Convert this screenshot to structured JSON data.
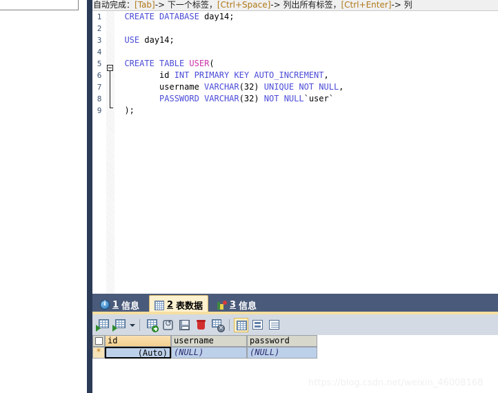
{
  "hint_bar": {
    "prefix": "自动完成：",
    "segments": [
      {
        "key": "[Tab]",
        "arrow": "-> ",
        "text": "下一个标签，"
      },
      {
        "key": "[Ctrl+Space]",
        "arrow": "-> ",
        "text": "列出所有标签，"
      },
      {
        "key": "[Ctrl+Enter]",
        "arrow": "-> ",
        "text": "列"
      }
    ],
    "full_text": "自动完成：[Tab]-> 下一个标签，[Ctrl+Space]-> 列出所有标签，[Ctrl+Enter]-> 列"
  },
  "editor": {
    "line_numbers": [
      "1",
      "2",
      "3",
      "4",
      "5",
      "6",
      "7",
      "8",
      "9"
    ],
    "lines": [
      {
        "n": "1",
        "tokens": [
          {
            "t": "  ",
            "c": "plain"
          },
          {
            "t": "CREATE",
            "c": "kw"
          },
          {
            "t": " ",
            "c": "plain"
          },
          {
            "t": "DATABASE",
            "c": "kw"
          },
          {
            "t": " day14;",
            "c": "plain"
          }
        ]
      },
      {
        "n": "2",
        "tokens": []
      },
      {
        "n": "3",
        "tokens": [
          {
            "t": "  ",
            "c": "plain"
          },
          {
            "t": "USE",
            "c": "kw"
          },
          {
            "t": " day14;",
            "c": "plain"
          }
        ]
      },
      {
        "n": "4",
        "tokens": []
      },
      {
        "n": "5",
        "tokens": [
          {
            "t": "  ",
            "c": "plain"
          },
          {
            "t": "CREATE",
            "c": "kw"
          },
          {
            "t": " ",
            "c": "plain"
          },
          {
            "t": "TABLE",
            "c": "kw"
          },
          {
            "t": " ",
            "c": "plain"
          },
          {
            "t": "USER",
            "c": "tbl"
          },
          {
            "t": "(",
            "c": "plain"
          }
        ]
      },
      {
        "n": "6",
        "tokens": [
          {
            "t": "         id ",
            "c": "plain"
          },
          {
            "t": "INT",
            "c": "kw"
          },
          {
            "t": " ",
            "c": "plain"
          },
          {
            "t": "PRIMARY",
            "c": "kw"
          },
          {
            "t": " ",
            "c": "plain"
          },
          {
            "t": "KEY",
            "c": "kw"
          },
          {
            "t": " ",
            "c": "plain"
          },
          {
            "t": "AUTO_INCREMENT",
            "c": "kw"
          },
          {
            "t": ",",
            "c": "plain"
          }
        ]
      },
      {
        "n": "7",
        "tokens": [
          {
            "t": "         username ",
            "c": "plain"
          },
          {
            "t": "VARCHAR",
            "c": "kw"
          },
          {
            "t": "(32) ",
            "c": "plain"
          },
          {
            "t": "UNIQUE",
            "c": "kw"
          },
          {
            "t": " ",
            "c": "plain"
          },
          {
            "t": "NOT",
            "c": "kw"
          },
          {
            "t": " ",
            "c": "plain"
          },
          {
            "t": "NULL",
            "c": "kw"
          },
          {
            "t": ",",
            "c": "plain"
          }
        ]
      },
      {
        "n": "8",
        "tokens": [
          {
            "t": "         ",
            "c": "plain"
          },
          {
            "t": "PASSWORD",
            "c": "kw"
          },
          {
            "t": " ",
            "c": "plain"
          },
          {
            "t": "VARCHAR",
            "c": "kw"
          },
          {
            "t": "(32) ",
            "c": "plain"
          },
          {
            "t": "NOT",
            "c": "kw"
          },
          {
            "t": " ",
            "c": "plain"
          },
          {
            "t": "NULL",
            "c": "kw"
          },
          {
            "t": "`user`",
            "c": "plain"
          }
        ]
      },
      {
        "n": "9",
        "tokens": [
          {
            "t": "  );",
            "c": "plain"
          }
        ]
      }
    ],
    "full_sql": "CREATE DATABASE day14;\n\nUSE day14;\n\nCREATE TABLE USER(\n         id INT PRIMARY KEY AUTO_INCREMENT,\n         username VARCHAR(32) UNIQUE NOT NULL,\n         PASSWORD VARCHAR(32) NOT NULL`user`\n);",
    "fold_marker": "collapse-fold-marker"
  },
  "result_tabs": [
    {
      "num": "1",
      "label": "信息",
      "icon": "info-icon",
      "active": false
    },
    {
      "num": "2",
      "label": "表数据",
      "icon": "grid-icon",
      "active": true
    },
    {
      "num": "3",
      "label": "信息",
      "icon": "chart-icon",
      "active": false
    }
  ],
  "grid_toolbar": [
    {
      "name": "apply-filter-button",
      "icon": "sheet-arrow-icon"
    },
    {
      "name": "filter-options-button",
      "icon": "sheet-arrow-icon"
    },
    {
      "name": "filter-dropdown-caret",
      "icon": "chevron-down-icon"
    },
    {
      "name": "add-record-button",
      "icon": "sheet-plus-icon"
    },
    {
      "name": "refresh-record-button",
      "icon": "undo-icon"
    },
    {
      "name": "save-record-button",
      "icon": "floppy-save-icon"
    },
    {
      "name": "delete-record-button",
      "icon": "trash-icon"
    },
    {
      "name": "cancel-edit-button",
      "icon": "sheet-cancel-icon"
    },
    {
      "name": "grid-view-button",
      "icon": "grid-view-icon",
      "selected": true
    },
    {
      "name": "form-view-button",
      "icon": "form-view-icon"
    },
    {
      "name": "text-view-button",
      "icon": "text-view-icon"
    }
  ],
  "data_grid": {
    "columns": [
      "id",
      "username",
      "password"
    ],
    "rows": [
      {
        "marker": "*",
        "cells": [
          "(Auto)",
          "(NULL)",
          "(NULL)"
        ]
      }
    ],
    "selected_cell": "id",
    "key_column": "id"
  },
  "watermark": "https://blog.csdn.net/weixin_46008168",
  "colors": {
    "tabbar_bg": "#4a5a7a",
    "tab_active_bg": "#fdf1cf",
    "tabbar_underline": "#f6dfa0",
    "toolbar_bg": "#d3dae3",
    "nav_strip": "#2b3a55",
    "keyword": "#4b4bd8",
    "table_name": "#cc33aa",
    "grid_header": "#d7d7cc",
    "key_header": "#f2cf8e",
    "row_selected": "#bdd0ea"
  }
}
